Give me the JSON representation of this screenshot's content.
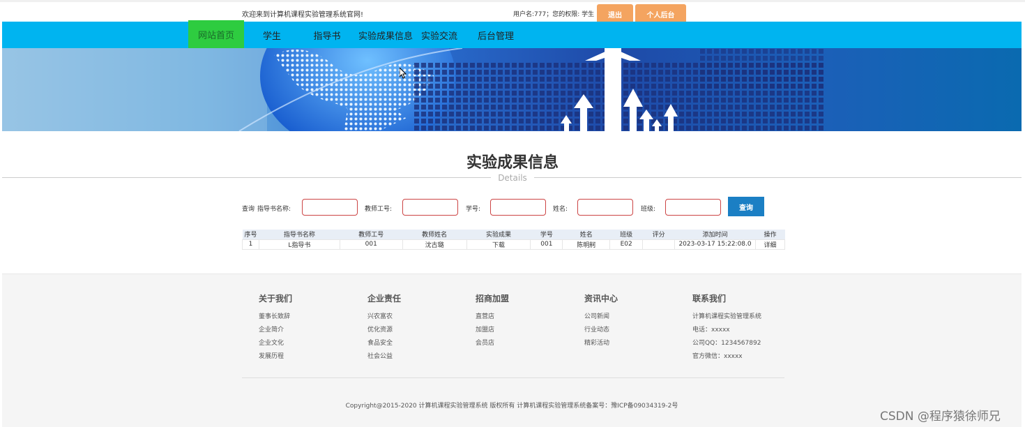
{
  "topbar": {
    "welcome": "欢迎来到计算机课程实验管理系统官网!",
    "user_info": "用户名:777；您的权限: 学生",
    "logout_label": "退出",
    "personal_label": "个人后台",
    "accent_color": "#f4a460"
  },
  "nav": {
    "items": [
      {
        "label": "网站首页"
      },
      {
        "label": "学生"
      },
      {
        "label": "指导书"
      },
      {
        "label": "实验成果信息"
      },
      {
        "label": "实验交流"
      },
      {
        "label": "后台管理"
      }
    ],
    "bg_color": "#00b4f0",
    "active_color": "#2ecc40"
  },
  "section": {
    "title": "实验成果信息",
    "subtitle": "Details"
  },
  "search": {
    "prefix": "查询",
    "fields": [
      {
        "label": "指导书名称:",
        "value": ""
      },
      {
        "label": "教师工号:",
        "value": ""
      },
      {
        "label": "学号:",
        "value": ""
      },
      {
        "label": "姓名:",
        "value": ""
      },
      {
        "label": "班级:",
        "value": ""
      }
    ],
    "button_label": "查询"
  },
  "table": {
    "headers": [
      "序号",
      "指导书名称",
      "教师工号",
      "教师姓名",
      "实验成果",
      "学号",
      "姓名",
      "班级",
      "评分",
      "添加时间",
      "操作"
    ],
    "rows": [
      [
        "1",
        "L指导书",
        "001",
        "沈古璐",
        "下载",
        "001",
        "陈明舸",
        "E02",
        "",
        "2023-03-17 15:22:08.0",
        "详细"
      ]
    ]
  },
  "footer": {
    "columns": [
      {
        "title": "关于我们",
        "links": [
          "董事长致辞",
          "企业简介",
          "企业文化",
          "发展历程"
        ]
      },
      {
        "title": "企业责任",
        "links": [
          "兴农富农",
          "优化资源",
          "食品安全",
          "社会公益"
        ]
      },
      {
        "title": "招商加盟",
        "links": [
          "直营店",
          "加盟店",
          "会员店"
        ]
      },
      {
        "title": "资讯中心",
        "links": [
          "公司新闻",
          "行业动态",
          "精彩活动"
        ]
      },
      {
        "title": "联系我们",
        "links": [
          "计算机课程实验管理系统",
          "电话：xxxxx",
          "公司QQ：1234567892",
          "官方微信：xxxxx"
        ]
      }
    ],
    "copyright": "Copyright@2015-2020 计算机课程实验管理系统 版权所有 计算机课程实验管理系统备案号：豫ICP备09034319-2号"
  },
  "watermark": "CSDN @程序猿徐师兄"
}
